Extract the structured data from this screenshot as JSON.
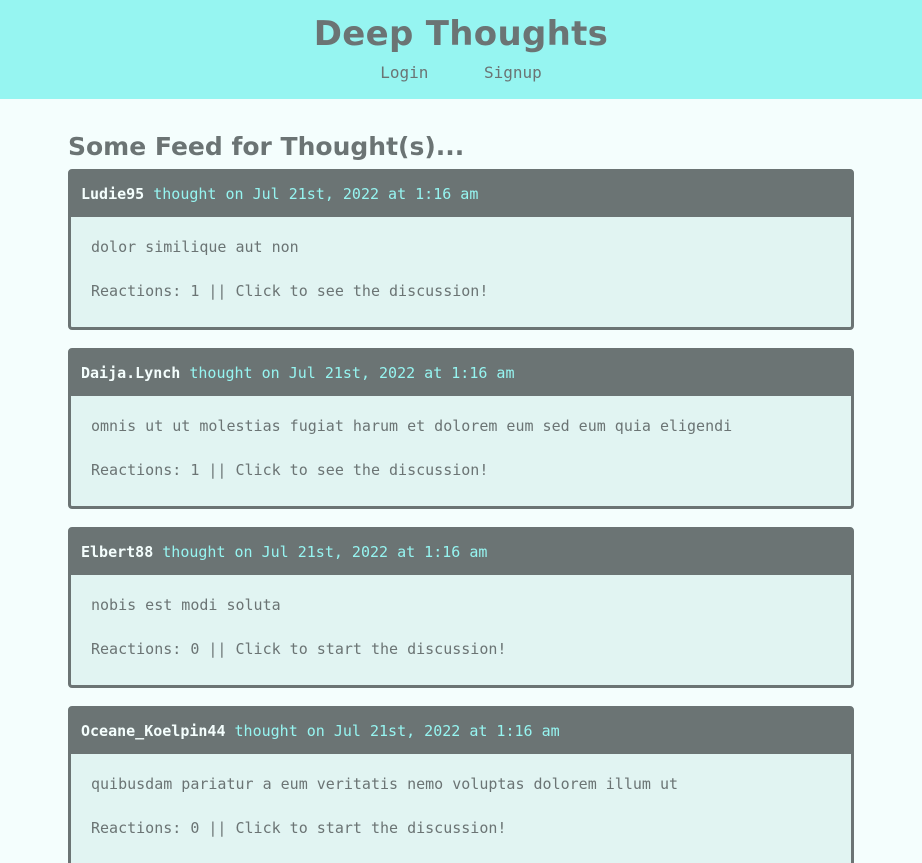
{
  "header": {
    "title": "Deep Thoughts",
    "nav": {
      "login": "Login",
      "signup": "Signup"
    }
  },
  "feed": {
    "title": "Some Feed for Thought(s)...",
    "thoughts": [
      {
        "username": "Ludie95",
        "meta": "thought on Jul 21st, 2022 at 1:16 am",
        "text": "dolor similique aut non",
        "reactions": "Reactions: 1 || Click to see the discussion!"
      },
      {
        "username": "Daija.Lynch",
        "meta": "thought on Jul 21st, 2022 at 1:16 am",
        "text": "omnis ut ut molestias fugiat harum et dolorem eum sed eum quia eligendi",
        "reactions": "Reactions: 1 || Click to see the discussion!"
      },
      {
        "username": "Elbert88",
        "meta": "thought on Jul 21st, 2022 at 1:16 am",
        "text": "nobis est modi soluta",
        "reactions": "Reactions: 0 || Click to start the discussion!"
      },
      {
        "username": "Oceane_Koelpin44",
        "meta": "thought on Jul 21st, 2022 at 1:16 am",
        "text": "quibusdam pariatur a eum veritatis nemo voluptas dolorem illum ut",
        "reactions": "Reactions: 0 || Click to start the discussion!"
      }
    ]
  },
  "colors": {
    "header_bg": "#96f5f1",
    "page_bg": "#f4fefd",
    "card_header_bg": "#6b7474",
    "card_body_bg": "#e1f4f2",
    "text": "#6b7474",
    "accent": "#96f5f1"
  }
}
